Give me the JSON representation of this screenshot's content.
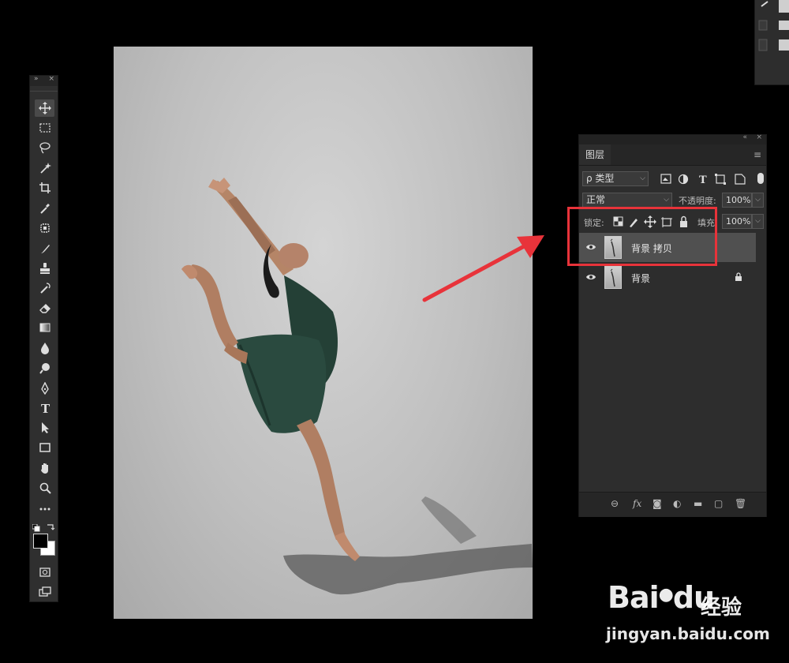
{
  "toolbar": {
    "header_collapse": "»",
    "header_close": "×",
    "tools": [
      {
        "name": "move-tool",
        "icon": "move-icon",
        "active": true
      },
      {
        "name": "marquee-tool",
        "icon": "rect-marquee-icon"
      },
      {
        "name": "lasso-tool",
        "icon": "lasso-icon"
      },
      {
        "name": "magic-wand-tool",
        "icon": "magic-wand-icon"
      },
      {
        "name": "crop-tool",
        "icon": "crop-icon"
      },
      {
        "name": "eyedropper-tool",
        "icon": "eyedropper-icon"
      },
      {
        "name": "healing-tool",
        "icon": "healing-icon"
      },
      {
        "name": "brush-tool",
        "icon": "brush-icon"
      },
      {
        "name": "stamp-tool",
        "icon": "stamp-icon"
      },
      {
        "name": "history-brush-tool",
        "icon": "history-brush-icon"
      },
      {
        "name": "eraser-tool",
        "icon": "eraser-icon"
      },
      {
        "name": "gradient-tool",
        "icon": "gradient-icon"
      },
      {
        "name": "blur-tool",
        "icon": "blur-icon"
      },
      {
        "name": "dodge-tool",
        "icon": "dodge-icon"
      },
      {
        "name": "pen-tool",
        "icon": "pen-icon"
      },
      {
        "name": "type-tool",
        "icon": "type-icon"
      },
      {
        "name": "path-select-tool",
        "icon": "path-select-icon"
      },
      {
        "name": "shape-tool",
        "icon": "rectangle-icon"
      },
      {
        "name": "hand-tool",
        "icon": "hand-icon"
      },
      {
        "name": "zoom-tool",
        "icon": "zoom-icon"
      },
      {
        "name": "more-tools",
        "icon": "ellipsis-icon"
      }
    ],
    "fg_color": "#000000",
    "bg_color": "#ffffff"
  },
  "layers_panel": {
    "collapse": "«",
    "close": "×",
    "tab_label": "图层",
    "menu_icon": "≡",
    "filter": {
      "label": "ρ 类型"
    },
    "blend_mode": "正常",
    "opacity_label": "不透明度:",
    "opacity_value": "100%",
    "lock_label": "锁定:",
    "fill_label": "填充:",
    "fill_value": "100%",
    "layers": [
      {
        "name": "背景 拷贝",
        "selected": true,
        "visible": true,
        "locked": false
      },
      {
        "name": "背景",
        "selected": false,
        "visible": true,
        "locked": true
      }
    ],
    "footer": {
      "fx_label": "fx"
    }
  },
  "watermark": {
    "logo_text": "Bai",
    "logo_text2": "du",
    "cn_text": "经验",
    "url": "jingyan.baidu.com"
  },
  "colors": {
    "highlight": "#e8333a",
    "panel_bg": "#2d2d2d",
    "selected_layer": "#505050"
  }
}
